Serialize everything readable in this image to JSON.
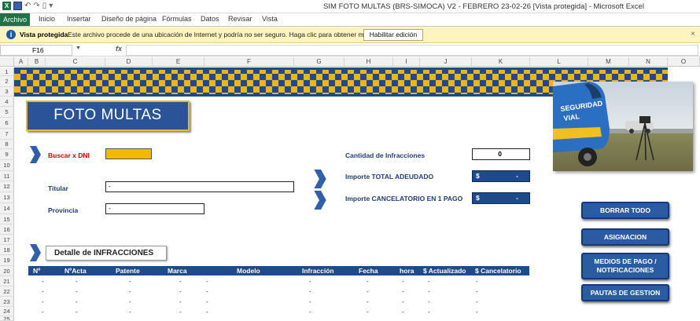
{
  "window": {
    "title": "SIM FOTO MULTAS (BRS-SIMOCA) V2 - FEBRERO 23-02-26  [Vista protegida]  -  Microsoft Excel"
  },
  "ribbon": {
    "tabs": [
      "Archivo",
      "Inicio",
      "Insertar",
      "Diseño de página",
      "Fórmulas",
      "Datos",
      "Revisar",
      "Vista"
    ]
  },
  "protected_view": {
    "title": "Vista protegida",
    "message": "Este archivo procede de una ubicación de Internet y podría no ser seguro. Haga clic para obtener más detalles.",
    "button": "Habilitar edición"
  },
  "formula_bar": {
    "name_box": "F16",
    "fx": "fx",
    "formula": ""
  },
  "columns": [
    "A",
    "B",
    "C",
    "D",
    "E",
    "F",
    "G",
    "H",
    "I",
    "J",
    "K",
    "L",
    "M",
    "N",
    "O"
  ],
  "rows": [
    "1",
    "2",
    "3",
    "4",
    "5",
    "6",
    "7",
    "8",
    "9",
    "10",
    "11",
    "12",
    "13",
    "14",
    "15",
    "16",
    "17",
    "18",
    "19",
    "20",
    "21",
    "22",
    "23",
    "24",
    "25"
  ],
  "sheet": {
    "title": "FOTO MULTAS",
    "search_label": "Buscar x DNI",
    "search_value": "",
    "titular_label": "Titular",
    "titular_value": "-",
    "provincia_label": "Provincia",
    "provincia_value": "-",
    "cantidad_label": "Cantidad de Infracciones",
    "cantidad_value": "0",
    "importe_total_label": "Importe TOTAL ADEUDADO",
    "importe_total_currency": "$",
    "importe_total_value": "-",
    "importe_cancel_label": "Importe CANCELATORIO EN 1 PAGO",
    "importe_cancel_currency": "$",
    "importe_cancel_value": "-",
    "detalle_title": "Detalle de INFRACCIONES",
    "photo_text_1": "SEGURIDAD",
    "photo_text_2": "VIAL"
  },
  "table": {
    "headers": [
      "Nº",
      "NºActa",
      "Patente",
      "Marca",
      "Modelo",
      "Infracción",
      "Fecha",
      "hora",
      "$ Actualizado",
      "$ Cancelatorio"
    ],
    "placeholder": "-"
  },
  "side_buttons": {
    "borrar": "BORRAR TODO",
    "asignacion": "ASIGNACION",
    "medios_1": "MEDIOS DE PAGO /",
    "medios_2": "NOTIFICACIONES",
    "pautas": "PAUTAS DE GESTION"
  },
  "colors": {
    "accent_blue": "#1d4b8c",
    "accent_yellow": "#f0b41a",
    "excel_green": "#207245"
  }
}
